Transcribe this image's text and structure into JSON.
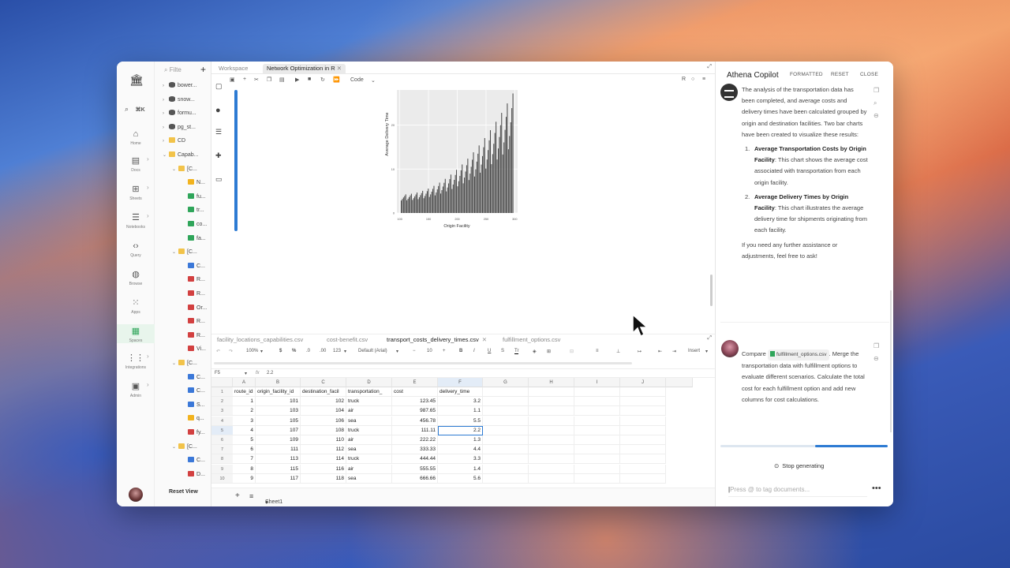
{
  "rail": {
    "search_shortcut": "⌘K",
    "items": [
      {
        "label": "Home",
        "icon": "home-icon"
      },
      {
        "label": "Docs",
        "icon": "docs-icon"
      },
      {
        "label": "Sheets",
        "icon": "sheets-icon"
      },
      {
        "label": "Notebooks",
        "icon": "notebooks-icon"
      },
      {
        "label": "Query",
        "icon": "query-icon"
      },
      {
        "label": "Browse",
        "icon": "browse-icon"
      },
      {
        "label": "Apps",
        "icon": "apps-icon"
      },
      {
        "label": "Spaces",
        "icon": "spaces-icon"
      },
      {
        "label": "Integrations",
        "icon": "integrations-icon"
      },
      {
        "label": "Admin",
        "icon": "admin-icon"
      }
    ]
  },
  "tree": {
    "filter_placeholder": "Filte",
    "reset_view": "Reset View",
    "items": [
      "bower...",
      "snow...",
      "formu...",
      "pg_st...",
      "CD",
      "Capab...",
      "[C...",
      "N...",
      "fu...",
      "tr...",
      "co...",
      "fa...",
      "[C...",
      "C...",
      "R...",
      "R...",
      "Or...",
      "R...",
      "R...",
      "Vi...",
      "[C...",
      "C...",
      "C...",
      "S...",
      "q...",
      "fy...",
      "[C...",
      "C...",
      "D..."
    ]
  },
  "main": {
    "tabs": [
      "Workspace",
      "Network Optimization in R"
    ],
    "cell_type": "Code",
    "kernel": "R",
    "file_tabs": [
      "facility_locations_capabilities.csv",
      "cost-benefit.csv",
      "transport_costs_delivery_times.csv",
      "fulfillment_options.csv"
    ],
    "toolbar": {
      "zoom": "100%",
      "currency": "$",
      "percent": "%",
      "format": "123",
      "font": "Default (Arial)",
      "font_size": "10",
      "insert": "Insert"
    },
    "cell_ref": "F5",
    "fx": "fx",
    "formula_value": "2.2",
    "sheet_name": "Sheet1",
    "columns": [
      "A",
      "B",
      "C",
      "D",
      "E",
      "F",
      "G",
      "H",
      "I",
      "J"
    ],
    "headers": [
      "route_id",
      "origin_facility_id",
      "destination_facil",
      "transportation_",
      "cost",
      "delivery_time"
    ],
    "rows": [
      [
        "1",
        "101",
        "102",
        "truck",
        "123.45",
        "3.2"
      ],
      [
        "2",
        "103",
        "104",
        "air",
        "987.65",
        "1.1"
      ],
      [
        "3",
        "105",
        "106",
        "sea",
        "456.78",
        "5.5"
      ],
      [
        "4",
        "107",
        "108",
        "truck",
        "111.11",
        "2.2"
      ],
      [
        "5",
        "109",
        "110",
        "air",
        "222.22",
        "1.3"
      ],
      [
        "6",
        "111",
        "112",
        "sea",
        "333.33",
        "4.4"
      ],
      [
        "7",
        "113",
        "114",
        "truck",
        "444.44",
        "3.3"
      ],
      [
        "8",
        "115",
        "116",
        "air",
        "555.55",
        "1.4"
      ],
      [
        "9",
        "117",
        "118",
        "sea",
        "666.66",
        "5.6"
      ]
    ],
    "row_numbers": [
      "1",
      "2",
      "3",
      "4",
      "5",
      "6",
      "7",
      "8",
      "9",
      "10"
    ]
  },
  "chart_data": {
    "type": "bar",
    "xlabel": "Origin Facility",
    "ylabel": "Average Delivery Time",
    "xticks": [
      "100",
      "150",
      "200",
      "250",
      "300"
    ],
    "yticks": [
      "0",
      "10",
      "20"
    ],
    "ylim": [
      0,
      28
    ],
    "xlim": [
      95,
      305
    ],
    "trend": {
      "start": 3,
      "end": 26,
      "n": 100
    }
  },
  "copilot": {
    "title": "Athena Copilot",
    "actions": [
      "FORMATTED",
      "RESET",
      "CLOSE"
    ],
    "msg_intro": "The analysis of the transportation data has been completed, and average costs and delivery times have been calculated grouped by origin and destination facilities. Two bar charts have been created to visualize these results:",
    "item1_num": "1.",
    "item1_title": "Average Transportation Costs by Origin Facility",
    "item1_text": ": This chart shows the average cost associated with transportation from each origin facility.",
    "item2_num": "2.",
    "item2_title": "Average Delivery Times by Origin Facility",
    "item2_text": ": This chart illustrates the average delivery time for shipments originating from each facility.",
    "msg_outro": "If you need any further assistance or adjustments, feel free to ask!",
    "user_pre": "Compare",
    "user_chip": "fulfillment_options.csv",
    "user_post": ". Merge the transportation data with fulfillment options to evaluate different scenarios. Calculate the total cost for each fulfillment option and add new columns for cost calculations.",
    "stop": "Stop generating",
    "input_placeholder": "Press @ to tag documents...",
    "more": "•••"
  }
}
